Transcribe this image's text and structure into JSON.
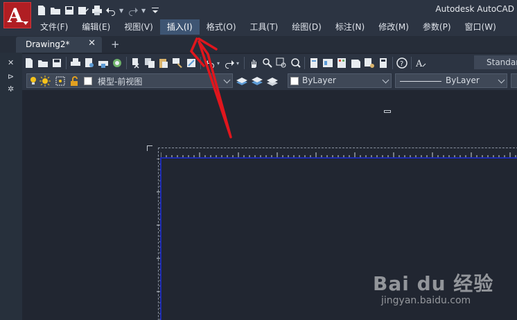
{
  "app": {
    "title": "Autodesk AutoCAD",
    "logo_letter": "A"
  },
  "menu": {
    "items": [
      {
        "label": "文件(F)"
      },
      {
        "label": "编辑(E)"
      },
      {
        "label": "视图(V)"
      },
      {
        "label": "插入(I)",
        "active": true
      },
      {
        "label": "格式(O)"
      },
      {
        "label": "工具(T)"
      },
      {
        "label": "绘图(D)"
      },
      {
        "label": "标注(N)"
      },
      {
        "label": "修改(M)"
      },
      {
        "label": "参数(P)"
      },
      {
        "label": "窗口(W)"
      }
    ]
  },
  "tabs": {
    "document": "Drawing2*",
    "close_glyph": "✕",
    "new_glyph": "+"
  },
  "toolbar": {
    "text_style": "Standard",
    "layer_name": "模型-前视图",
    "color": "ByLayer",
    "linetype": "ByLayer"
  },
  "leftstrip": {
    "close_glyph": "✕",
    "pin_glyph": "⊳",
    "settings_glyph": "✲"
  },
  "watermark": {
    "brand": "Bai du 经验",
    "url": "jingyan.baidu.com"
  },
  "colors": {
    "titlebar": "#2c3442",
    "canvas": "#212631",
    "active_menu": "#3e5573",
    "logo_red": "#b01e23",
    "paper_border": "#1d2bb2",
    "annotation_red": "#e0161d"
  }
}
